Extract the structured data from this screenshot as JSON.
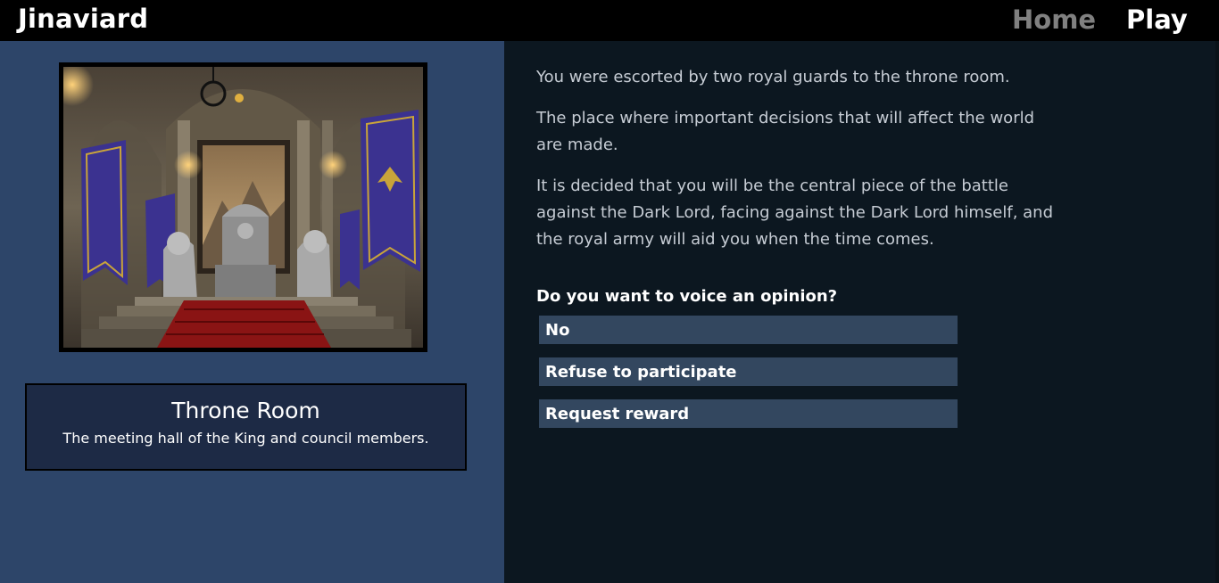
{
  "header": {
    "brand": "Jinaviard",
    "nav": {
      "home": "Home",
      "play": "Play"
    }
  },
  "location": {
    "name": "Throne Room",
    "description": "The meeting hall of the King and council members."
  },
  "story": {
    "paragraphs": [
      "You were escorted by two royal guards to the throne room.",
      "The place where important decisions that will affect the world are made.",
      "It is decided that you will be the central piece of the battle against the Dark Lord, facing against the Dark Lord himself, and the royal army will aid you when the time comes."
    ]
  },
  "prompt": {
    "question": "Do you want to voice an opinion?",
    "choices": [
      "No",
      "Refuse to participate",
      "Request reward"
    ]
  },
  "colors": {
    "topbar": "#000000",
    "left_panel": "#2d4569",
    "right_panel": "#0c1720",
    "choice_bg": "#33475f",
    "card_bg": "#1d2a45",
    "banner_purple": "#3b3290",
    "banner_gold": "#c9a43a"
  }
}
